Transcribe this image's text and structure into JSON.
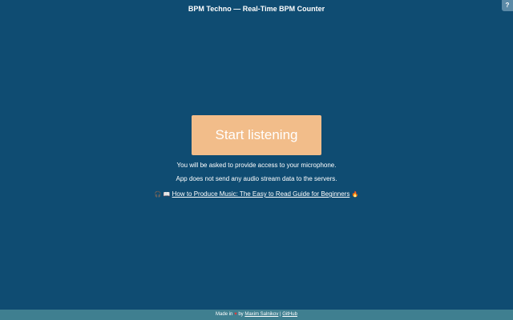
{
  "header": {
    "title": "BPM Techno — Real-Time BPM Counter",
    "help_label": "?"
  },
  "main": {
    "start_label": "Start listening",
    "info_mic": "You will be asked to provide access to your microphone.",
    "info_stream": "App does not send any audio stream data to the servers.",
    "guide": {
      "icons": [
        "headphones-icon",
        "book-icon",
        "fire-icon"
      ],
      "text": "How to Produce Music: The Easy to Read Guide for Beginners"
    }
  },
  "footer": {
    "made_in": "Made in",
    "by": "by",
    "author": "Maxim Salnikov",
    "separator": "|",
    "github": "GitHub"
  },
  "colors": {
    "background": "#0f4c72",
    "button": "#f2bd8a",
    "footer": "#3f7f90"
  }
}
